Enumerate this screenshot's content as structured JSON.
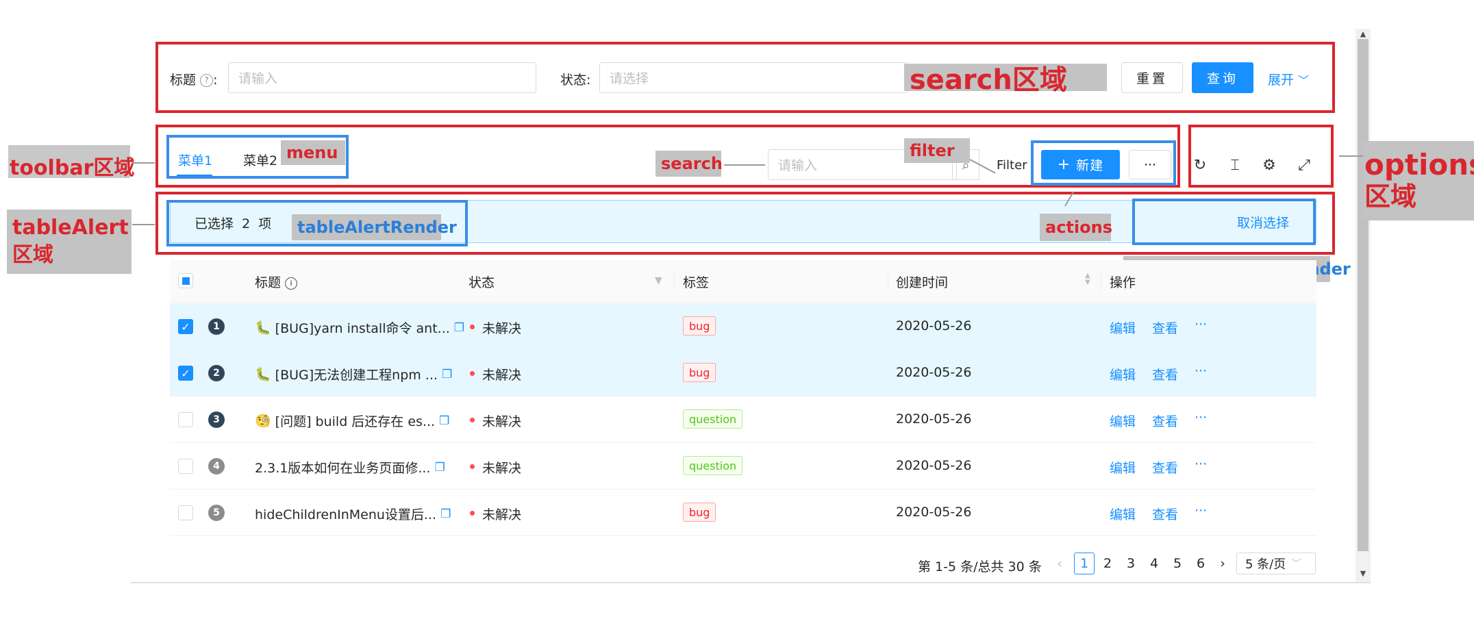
{
  "search": {
    "title_label": "标题",
    "title_placeholder": "请输入",
    "status_label": "状态",
    "status_placeholder": "请选择",
    "reset_label": "重置",
    "query_label": "查询",
    "expand_label": "展开",
    "annotation": "search区域"
  },
  "toolbar": {
    "menu": [
      "菜单1",
      "菜单2"
    ],
    "search_placeholder": "请输入",
    "filter_label": "Filter",
    "new_label": "新建",
    "more_label": "···",
    "annotations": {
      "toolbar": "toolbar区域",
      "menu": "menu",
      "search": "search",
      "filter": "filter",
      "actions": "actions",
      "options_line1": "options",
      "options_line2": "区域"
    }
  },
  "alert": {
    "selected_prefix": "已选择",
    "selected_count": "2",
    "selected_suffix": "项",
    "cancel_label": "取消选择",
    "annotations": {
      "table_alert_line1": "tableAlert",
      "table_alert_line2": "区域",
      "render": "tableAlertRender",
      "option_render": "tableAlertOptionRender"
    }
  },
  "table": {
    "headers": [
      "标题",
      "状态",
      "标签",
      "创建时间",
      "操作"
    ],
    "rows": [
      {
        "num": "1",
        "emoji": "🐛",
        "title": "[BUG]yarn install命令 ant...",
        "status": "未解决",
        "tag": "bug",
        "date": "2020-05-26",
        "selected": true,
        "badge_color": "#314659"
      },
      {
        "num": "2",
        "emoji": "🐛",
        "title": "[BUG]无法创建工程npm ...",
        "status": "未解决",
        "tag": "bug",
        "date": "2020-05-26",
        "selected": true,
        "badge_color": "#314659"
      },
      {
        "num": "3",
        "emoji": "🧐",
        "title": "[问题] build 后还存在 es...",
        "status": "未解决",
        "tag": "question",
        "date": "2020-05-26",
        "selected": false,
        "badge_color": "#314659"
      },
      {
        "num": "4",
        "emoji": "",
        "title": "2.3.1版本如何在业务页面修...",
        "status": "未解决",
        "tag": "question",
        "date": "2020-05-26",
        "selected": false,
        "badge_color": "#8c8c8c"
      },
      {
        "num": "5",
        "emoji": "",
        "title": "hideChildrenInMenu设置后...",
        "status": "未解决",
        "tag": "bug",
        "date": "2020-05-26",
        "selected": false,
        "badge_color": "#8c8c8c"
      }
    ],
    "actions": {
      "edit": "编辑",
      "view": "查看",
      "more": "···"
    }
  },
  "pagination": {
    "total_text": "第 1-5 条/总共 30 条",
    "pages": [
      "1",
      "2",
      "3",
      "4",
      "5",
      "6"
    ],
    "current": "1",
    "page_size": "5 条/页"
  },
  "colors": {
    "primary": "#1890ff",
    "annotation_red": "#d9262e",
    "annotation_blue": "#3a8ee6",
    "selected_row": "#e6f7ff"
  }
}
